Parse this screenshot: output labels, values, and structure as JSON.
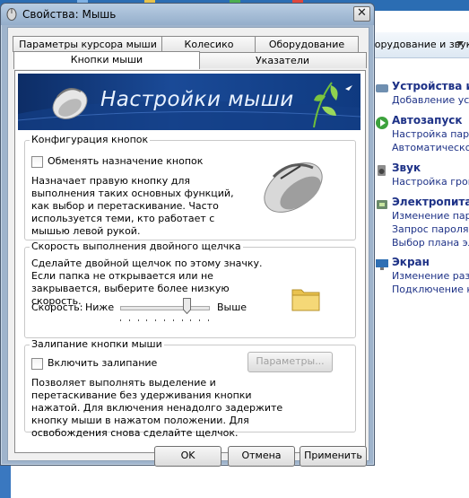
{
  "background": {
    "toolbar_text": "борудование и звук",
    "items": [
      {
        "title": "Устройства и п",
        "subs": [
          "Добавление устр"
        ]
      },
      {
        "title": "Автозапуск",
        "subs": [
          "Настройка парам",
          "Автоматическое"
        ]
      },
      {
        "title": "Звук",
        "subs": [
          "Настройка громк"
        ]
      },
      {
        "title": "Электропитани",
        "subs": [
          "Изменение парам",
          "Запрос пароля п",
          "Выбор плана эле"
        ]
      },
      {
        "title": "Экран",
        "subs": [
          "Изменение разме",
          "Подключение к в"
        ]
      }
    ]
  },
  "window": {
    "title": "Свойства: Мышь",
    "close_symbol": "✕",
    "tabs_back": [
      "Параметры курсора мыши",
      "Колесико",
      "Оборудование"
    ],
    "tabs_front": [
      "Кнопки мыши",
      "Указатели"
    ],
    "banner_title": "Настройки мыши",
    "button_config": {
      "label": "Конфигурация кнопок",
      "checkbox": "Обменять назначение кнопок",
      "description": "Назначает правую кнопку для выполнения таких основных функций, как выбор и перетаскивание. Часто используется теми, кто работает с мышью левой рукой."
    },
    "double_click": {
      "label": "Скорость выполнения двойного щелчка",
      "description": "Сделайте двойной щелчок по этому значку. Если папка не открывается или не закрывается, выберите более низкую скорость.",
      "speed_label": "Скорость:",
      "slow_label": "Ниже",
      "fast_label": "Выше",
      "speed_value": 0.75
    },
    "click_lock": {
      "label": "Залипание кнопки мыши",
      "checkbox": "Включить залипание",
      "settings_button": "Параметры...",
      "description": "Позволяет выполнять выделение и перетаскивание без удерживания кнопки нажатой. Для включения ненадолго задержите кнопку мыши в нажатом положении. Для освобождения снова сделайте щелчок."
    },
    "buttons": {
      "ok": "OK",
      "cancel": "Отмена",
      "apply": "Применить"
    }
  }
}
